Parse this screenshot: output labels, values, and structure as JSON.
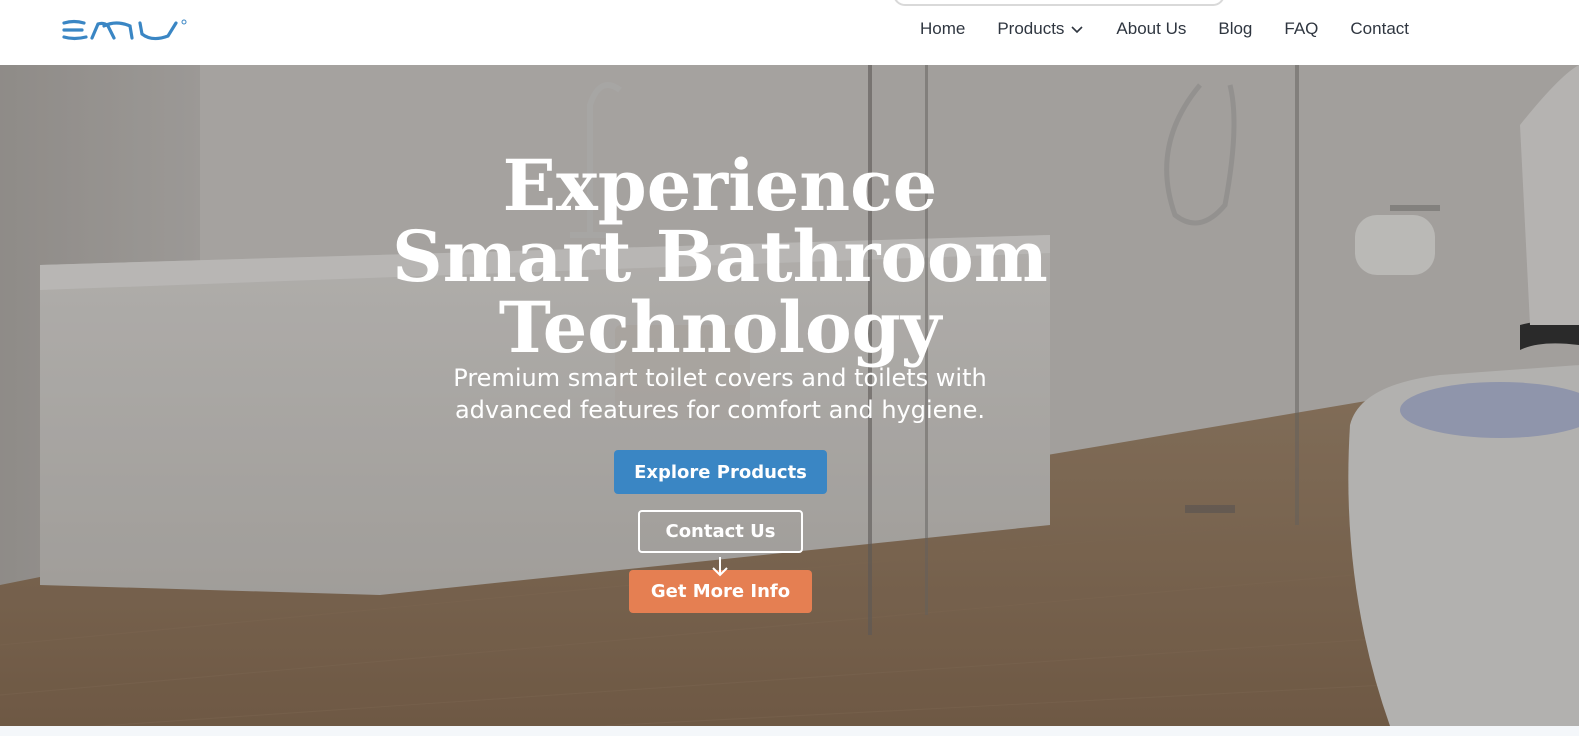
{
  "brand": {
    "logo_text": "EMU",
    "logo_color": "#3a86c4"
  },
  "nav": {
    "items": [
      {
        "label": "Home"
      },
      {
        "label": "Products",
        "has_dropdown": true
      },
      {
        "label": "About Us"
      },
      {
        "label": "Blog"
      },
      {
        "label": "FAQ"
      },
      {
        "label": "Contact"
      }
    ]
  },
  "hero": {
    "headline_line1": "Experience",
    "headline_line2": "Smart Bathroom",
    "headline_line3": "Technology",
    "subtitle": "Premium smart toilet covers and toilets with advanced features for comfort and hygiene.",
    "buttons": {
      "explore": "Explore Products",
      "contact": "Contact Us",
      "info": "Get More Info"
    },
    "colors": {
      "explore_bg": "#3a86c4",
      "info_bg": "#e57f52"
    },
    "icons": [
      "arrow-down-icon",
      "chevron-down-icon"
    ]
  }
}
